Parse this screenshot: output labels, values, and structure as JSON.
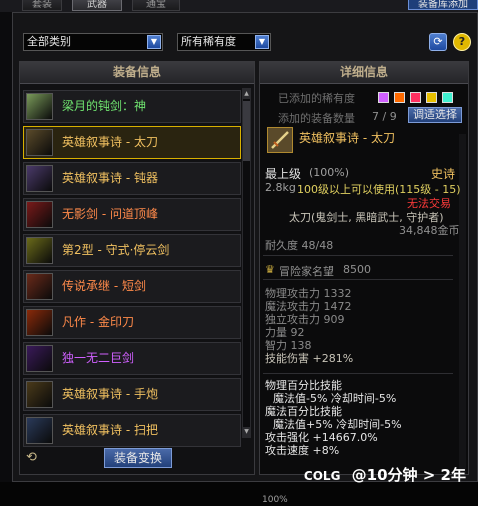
{
  "top_tabs": [
    "套装",
    "武器",
    "通宝"
  ],
  "top_right_label": "装备库添加",
  "filters": {
    "category": "全部类别",
    "rarity": "所有稀有度"
  },
  "left_panel": {
    "title": "装备信息",
    "items": [
      {
        "label": "梁月的钝剑：神",
        "color": "#6fe36f",
        "icon_bg": "#7a9a5a"
      },
      {
        "label": "英雄叙事诗 - 太刀",
        "color": "#f0c060",
        "icon_bg": "#5a4a2a"
      },
      {
        "label": "英雄叙事诗 - 钝器",
        "color": "#f0c060",
        "icon_bg": "#4a3a6a"
      },
      {
        "label": "无影剑 - 问道顶峰",
        "color": "#ff8a4a",
        "icon_bg": "#7a1a1a"
      },
      {
        "label": "第2型 - 守式·停云剑",
        "color": "#f0c060",
        "icon_bg": "#6a6a1a"
      },
      {
        "label": "传说承继 - 短剑",
        "color": "#ff8a4a",
        "icon_bg": "#6a2a1a"
      },
      {
        "label": "凡作 - 金印刀",
        "color": "#ff8a4a",
        "icon_bg": "#8a2a0a"
      },
      {
        "label": "独一无二巨剑",
        "color": "#d060ff",
        "icon_bg": "#3a1a5a"
      },
      {
        "label": "英雄叙事诗 - 手炮",
        "color": "#f0c060",
        "icon_bg": "#4a3a1a"
      },
      {
        "label": "英雄叙事诗 - 扫把",
        "color": "#f0c060",
        "icon_bg": "#2a3a5a"
      }
    ],
    "button": "装备变换"
  },
  "right_panel": {
    "title": "详细信息",
    "rarity_label": "已添加的稀有度",
    "rarity_colors": [
      "#d060ff",
      "#ff6a00",
      "#ff3060",
      "#e8c000",
      "#40f0d0"
    ],
    "count_label": "添加的装备数量",
    "count_value": "7 / 9",
    "count_button": "调适选择",
    "item_name": "英雄叙事诗 - 太刀",
    "grade": "最上级",
    "grade_pct": "(100%)",
    "rarity": "史诗",
    "weight": "2.8kg",
    "level_req": "100级以上可以使用(115级 - 15)",
    "trade": "无法交易",
    "classes": "太刀(鬼剑士, 黑暗武士, 守护者)",
    "price": "34,848金币",
    "durability": "耐久度 48/48",
    "adventurer": "冒险家名望",
    "adventurer_value": "8500",
    "stats": [
      "物理攻击力 1332",
      "魔法攻击力 1472",
      "独立攻击力 909",
      "力量 92",
      "智力 138",
      "技能伤害 +281%"
    ],
    "effects": [
      "物理百分比技能",
      "魔法值-5% 冷却时间-5%",
      "魔法百分比技能",
      "魔法值+5% 冷却时间-5%",
      "攻击强化 +14667.0%",
      "攻击速度 +8%"
    ]
  },
  "watermark": {
    "logo": "COLG",
    "text": "@10分钟 > 2年"
  },
  "bottom_pct": "100%"
}
